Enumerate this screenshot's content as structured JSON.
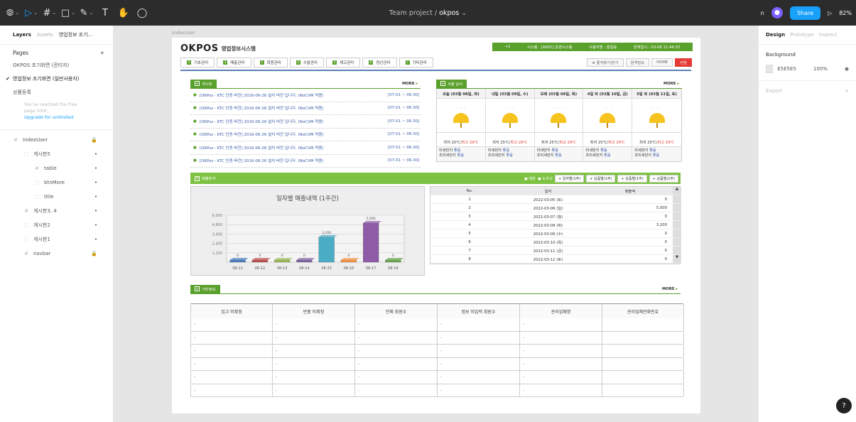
{
  "toolbar": {
    "tools": [
      {
        "name": "main-menu-icon",
        "glyph": "⦾",
        "caret": true
      },
      {
        "name": "move-tool-icon",
        "glyph": "▷",
        "caret": true,
        "active": true
      },
      {
        "name": "frame-tool-icon",
        "glyph": "#",
        "caret": true
      },
      {
        "name": "shape-tool-icon",
        "glyph": "□",
        "caret": true
      },
      {
        "name": "pen-tool-icon",
        "glyph": "✎",
        "caret": true
      },
      {
        "name": "text-tool-icon",
        "glyph": "T",
        "caret": false
      },
      {
        "name": "hand-tool-icon",
        "glyph": "✋",
        "caret": false
      },
      {
        "name": "comment-tool-icon",
        "glyph": "◯",
        "caret": false
      }
    ],
    "project": "Team project",
    "file": "okpos",
    "share_label": "Share",
    "zoom": "82%"
  },
  "left_panel": {
    "tabs": [
      "Layers",
      "Assets",
      "영업정보 조기..."
    ],
    "pages_label": "Pages",
    "pages": [
      "OKPOS 초기화면 (관리자)",
      "영업정보 조기화면 (일반사용자)",
      "상품등록"
    ],
    "current_page_index": 1,
    "limit_text": "You've reached the free page limit.",
    "upgrade_text": "Upgrade for unlimited",
    "layers": [
      {
        "name": "IndexUser",
        "icon": "#",
        "indent": 0,
        "right": "🔒"
      },
      {
        "name": "게시판5",
        "icon": "⬚",
        "indent": 1,
        "right": "•"
      },
      {
        "name": "table",
        "icon": "#",
        "indent": 2,
        "right": "•"
      },
      {
        "name": "btnMore",
        "icon": "⬚",
        "indent": 2,
        "right": "•"
      },
      {
        "name": "title",
        "icon": "⬚",
        "indent": 2,
        "right": "•"
      },
      {
        "name": "게시판3, 4",
        "icon": "#",
        "indent": 1,
        "right": "•"
      },
      {
        "name": "게시판2",
        "icon": "⬚",
        "indent": 1,
        "right": "•"
      },
      {
        "name": "게시판1",
        "icon": "⬚",
        "indent": 1,
        "right": "•"
      },
      {
        "name": "navbar",
        "icon": "#",
        "indent": 1,
        "right": "🔒"
      }
    ]
  },
  "right_panel": {
    "tabs": [
      "Design",
      "Prototype",
      "Inspect"
    ],
    "background_label": "Background",
    "bg_hex": "E5E5E5",
    "bg_opacity": "100%",
    "export_label": "Export"
  },
  "frame": {
    "label": "IndexUser",
    "logo_main": "OKP",
    "logo_accent": "OS",
    "system_name": "영업정보시스템",
    "info": [
      "+1",
      "시스템 : [A001] 운영시스템",
      "사용자명 : 홍길동",
      "현재일시 : 03-08 11:44:33"
    ],
    "nav": [
      {
        "num": "1",
        "label": "기초관리"
      },
      {
        "num": "2",
        "label": "매출관리"
      },
      {
        "num": "3",
        "label": "회원관리"
      },
      {
        "num": "4",
        "label": "수발관리"
      },
      {
        "num": "5",
        "label": "재고관리"
      },
      {
        "num": "6",
        "label": "정산관리"
      },
      {
        "num": "7",
        "label": "기타관리"
      }
    ],
    "nav_right": [
      "★ 즐겨찾기/닫기",
      "원격접속",
      "HOME",
      "전원"
    ],
    "board": {
      "title": "게시판",
      "more": "MORE",
      "rows": [
        {
          "text": "[OKPos - KTC 인증 버전] 2016-06-26 설치 버전 입니다. (NoCVM 적용)",
          "date": "[07-01 ~ 06-30]"
        },
        {
          "text": "[OKPos - KTC 인증 버전] 2016-06-26 설치 버전 입니다. (NoCVM 적용)",
          "date": "[07-01 ~ 06-30]"
        },
        {
          "text": "[OKPos - KTC 인증 버전] 2016-06-26 설치 버전 입니다. (NoCVM 적용)",
          "date": "[07-01 ~ 06-30]"
        },
        {
          "text": "[OKPos - KTC 인증 버전] 2016-06-26 설치 버전 입니다. (NoCVM 적용)",
          "date": "[07-01 ~ 06-30]"
        },
        {
          "text": "[OKPos - KTC 인증 버전] 2016-06-26 설치 버전 입니다. (NoCVM 적용)",
          "date": "[07-01 ~ 06-30]"
        },
        {
          "text": "[OKPos - KTC 인증 버전] 2016-06-26 설치 버전 입니다. (NoCVM 적용)",
          "date": "[07-01 ~ 06-30]"
        }
      ]
    },
    "weather": {
      "title": "서울 날씨",
      "more": "MORE",
      "days": [
        {
          "head": "오늘 (03월 08일, 화)",
          "lo": "최저 25℃",
          "hi": "최고 29℃",
          "dust": "미세먼지",
          "dust_v": "좋음",
          "fine": "초미세먼지",
          "fine_v": "좋음"
        },
        {
          "head": "내일 (03월 09일, 수)",
          "lo": "최저 25℃",
          "hi": "최고 29℃",
          "dust": "미세먼지",
          "dust_v": "좋음",
          "fine": "초미세먼지",
          "fine_v": "좋음"
        },
        {
          "head": "모레 (03월 09일, 목)",
          "lo": "최저 25℃",
          "hi": "최고 29℃",
          "dust": "미세먼지",
          "dust_v": "좋음",
          "fine": "초미세먼지",
          "fine_v": "좋음"
        },
        {
          "head": "4일 뒤 (03월 10일, 금)",
          "lo": "최저 25℃",
          "hi": "최고 29℃",
          "dust": "미세먼지",
          "dust_v": "좋음",
          "fine": "초미세먼지",
          "fine_v": "좋음"
        },
        {
          "head": "5일 뒤 (03월 11일, 토)",
          "lo": "최저 25℃",
          "hi": "최고 29℃",
          "dust": "미세먼지",
          "dust_v": "좋음",
          "fine": "초미세먼지",
          "fine_v": "좋음"
        }
      ]
    },
    "sales": {
      "title": "매출분석",
      "radios": [
        "● 매장",
        "● 도우넛"
      ],
      "buttons": [
        "+ 일자별(1주)",
        "+ 상품별(1주)",
        "+ 상품별(1주)",
        "+ 상품별(1주)"
      ],
      "table_head": [
        "No.",
        "일자",
        "매출액"
      ],
      "rows": [
        {
          "no": "1",
          "date": "2022-03-05 (토)",
          "amount": "0"
        },
        {
          "no": "2",
          "date": "2022-03-06 (일)",
          "amount": "5,000"
        },
        {
          "no": "3",
          "date": "2022-03-07 (월)",
          "amount": "0"
        },
        {
          "no": "4",
          "date": "2022-03-08 (화)",
          "amount": "3,200"
        },
        {
          "no": "5",
          "date": "2022-03-09 (수)",
          "amount": "0"
        },
        {
          "no": "6",
          "date": "2022-03-10 (목)",
          "amount": "0"
        },
        {
          "no": "7",
          "date": "2022-03-11 (금)",
          "amount": "0"
        },
        {
          "no": "8",
          "date": "2022-03-12 (토)",
          "amount": "0"
        }
      ]
    },
    "other": {
      "title": "기타정보",
      "more": "MORE",
      "headers": [
        "입고 미확정",
        "반품 미확정",
        "전체 회원수",
        "정보 미입력 회원수",
        "관리업체명",
        "관리업체전화번호"
      ],
      "rows": [
        [
          "-",
          "-",
          "-",
          "-",
          "-",
          ""
        ],
        [
          "-",
          "-",
          "-",
          "-",
          "-",
          ""
        ],
        [
          "-",
          "-",
          "-",
          "-",
          "-",
          ""
        ],
        [
          "-",
          "-",
          "-",
          "-",
          "-",
          ""
        ],
        [
          "-",
          "-",
          "-",
          "-",
          "-",
          ""
        ],
        [
          "-",
          "-",
          "-",
          "-",
          "-",
          ""
        ]
      ]
    }
  },
  "chart_data": {
    "type": "bar",
    "title": "일자별 매출내역 (1주간)",
    "categories": [
      "08-11",
      "08-12",
      "08-13",
      "08-14",
      "08-15",
      "08-16",
      "08-17",
      "08-18"
    ],
    "values": [
      0,
      0,
      0,
      0,
      3200,
      0,
      5000,
      0
    ],
    "yticks": [
      "6,000",
      "4,800",
      "3,600",
      "2,400",
      "1,200"
    ],
    "ylim": [
      0,
      6000
    ],
    "colors": [
      "#4a7fc1",
      "#c0504d",
      "#9bbb59",
      "#8064a2",
      "#4bacc6",
      "#f79646",
      "#8e5ba6",
      "#6aa84f"
    ]
  }
}
